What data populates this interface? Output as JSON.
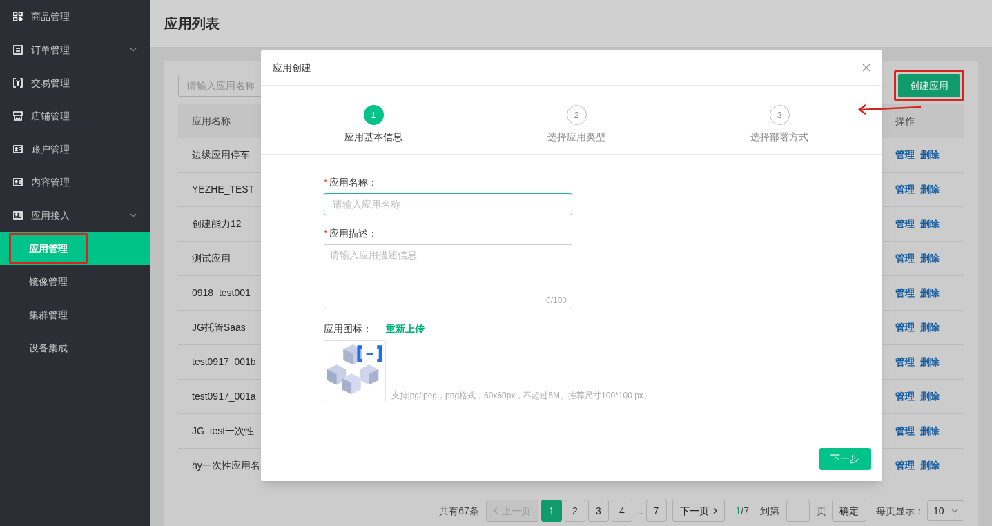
{
  "sidebar": {
    "items": [
      {
        "label": "商品管理",
        "expandable": false,
        "selected": false
      },
      {
        "label": "订单管理",
        "expandable": true,
        "selected": false
      },
      {
        "label": "交易管理",
        "expandable": false,
        "selected": false
      },
      {
        "label": "店铺管理",
        "expandable": false,
        "selected": false
      },
      {
        "label": "账户管理",
        "expandable": false,
        "selected": false
      },
      {
        "label": "内容管理",
        "expandable": false,
        "selected": false
      },
      {
        "label": "应用接入",
        "expandable": true,
        "selected": false,
        "children": [
          {
            "label": "应用管理",
            "selected": true,
            "highlighted": true
          },
          {
            "label": "镜像管理",
            "selected": false,
            "highlighted": false
          },
          {
            "label": "集群管理",
            "selected": false,
            "highlighted": false
          },
          {
            "label": "设备集成",
            "selected": false,
            "highlighted": false
          }
        ]
      }
    ]
  },
  "page": {
    "title": "应用列表",
    "search": {
      "placeholder": "请输入应用名称"
    },
    "create_button": {
      "label": "创建应用",
      "highlighted": true
    },
    "table": {
      "columns": [
        "应用名称",
        "操作"
      ],
      "rows": [
        {
          "name": "边缘应用停车",
          "actions": [
            "管理",
            "删除"
          ]
        },
        {
          "name": "YEZHE_TEST",
          "actions": [
            "管理",
            "删除"
          ]
        },
        {
          "name": "创建能力12",
          "actions": [
            "管理",
            "删除"
          ]
        },
        {
          "name": "测试应用",
          "actions": [
            "管理",
            "删除"
          ]
        },
        {
          "name": "0918_test001",
          "actions": [
            "管理",
            "删除"
          ]
        },
        {
          "name": "JG托管Saas",
          "actions": [
            "管理",
            "删除"
          ]
        },
        {
          "name": "test0917_001b",
          "actions": [
            "管理",
            "删除"
          ]
        },
        {
          "name": "test0917_001a",
          "actions": [
            "管理",
            "删除"
          ]
        },
        {
          "name": "JG_test一次性",
          "actions": [
            "管理",
            "删除"
          ]
        },
        {
          "name": "hy一次性应用名",
          "actions": [
            "管理",
            "删除"
          ]
        }
      ]
    },
    "pagination": {
      "total": "共有67条",
      "prev": {
        "label": "上一页",
        "disabled": true
      },
      "pages": [
        {
          "label": "1",
          "selected": true
        },
        {
          "label": "2",
          "selected": false
        },
        {
          "label": "3",
          "selected": false
        },
        {
          "label": "4",
          "selected": false
        },
        {
          "label": "...",
          "kind": "ellipsis"
        },
        {
          "label": "7",
          "selected": false
        }
      ],
      "next": {
        "label": "下一页",
        "disabled": false
      },
      "current": "1",
      "count": "/7",
      "goto_label": "到第",
      "page_unit": "页",
      "confirm": "确定",
      "per_page_label": "每页显示：",
      "per_page": "10"
    }
  },
  "modal": {
    "title": "应用创建",
    "steps": [
      {
        "number": "1",
        "label": "应用基本信息",
        "selected": true
      },
      {
        "number": "2",
        "label": "选择应用类型",
        "selected": false
      },
      {
        "number": "3",
        "label": "选择部署方式",
        "selected": false
      }
    ],
    "fields": [
      {
        "kind": "input",
        "required_mark": "*",
        "label": "应用名称：",
        "placeholder": "请输入应用名称",
        "focused": true
      },
      {
        "kind": "textarea",
        "required_mark": "*",
        "label": "应用描述：",
        "placeholder": "请输入应用描述信息",
        "counter": "0/100",
        "focused": false
      }
    ],
    "icon_field": {
      "label": "应用图标：",
      "link": "重新上传",
      "hint": "支持jpg/jpeg，png格式，60x60px，不超过5M。推荐尺寸100*100 px。"
    },
    "next_button": "下一步"
  }
}
